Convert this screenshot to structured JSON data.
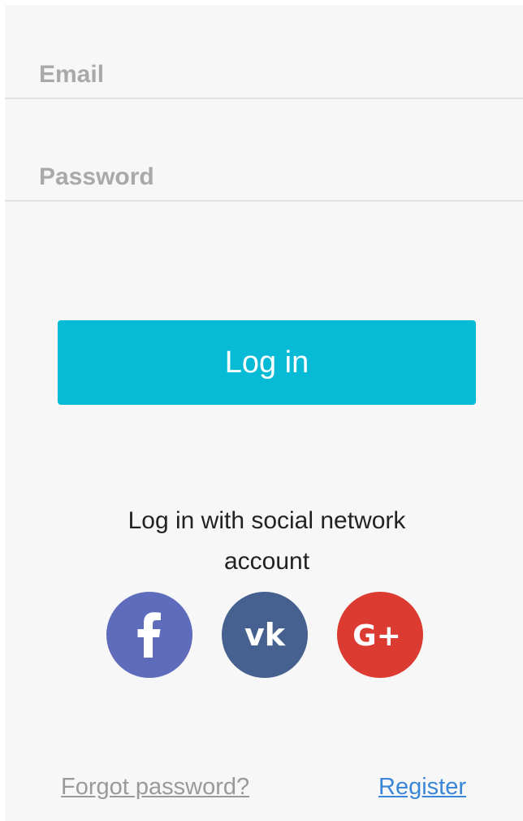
{
  "form": {
    "email": {
      "value": "",
      "placeholder": "Email"
    },
    "password": {
      "value": "",
      "placeholder": "Password"
    },
    "login_label": "Log in"
  },
  "social": {
    "text": "Log in with social network account",
    "buttons": [
      {
        "name": "facebook",
        "icon": "facebook-icon",
        "color": "#5f6cbb"
      },
      {
        "name": "vkontakte",
        "icon": "vk-icon",
        "color": "#46618f"
      },
      {
        "name": "google-plus",
        "icon": "google-plus-icon",
        "color": "#dc3b31"
      }
    ]
  },
  "links": {
    "forgot_password": "Forgot password?",
    "register": "Register"
  },
  "colors": {
    "background": "#f7f7f7",
    "accent": "#07bbd6",
    "link": "#3a86d8",
    "muted_link": "#9a9a9a"
  }
}
